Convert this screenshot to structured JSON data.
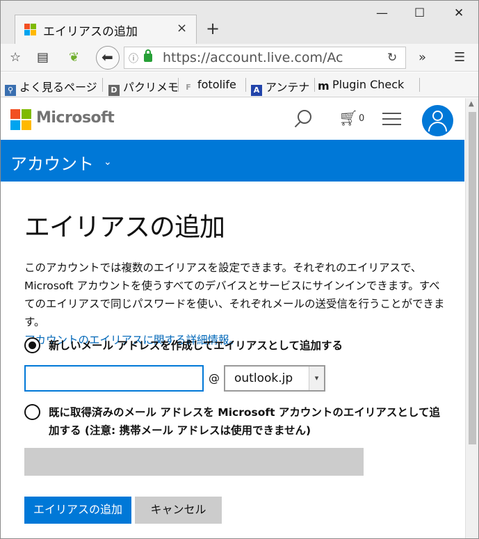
{
  "browser": {
    "tab_title": "エイリアスの追加",
    "tab_close": "×",
    "new_tab": "+",
    "window_controls": {
      "minimize": "—",
      "maximize": "☐",
      "close": "✕"
    },
    "url": "https://account.live.com/Ac",
    "toolbar_icons": [
      "star-icon",
      "reader-icon",
      "leaf-icon",
      "back-icon",
      "info-icon",
      "lock-icon",
      "reload-icon",
      "overflow-icon",
      "menu-icon"
    ],
    "bookmarks": [
      {
        "label": "よく見るページ",
        "icon": "magnifier-icon"
      },
      {
        "label": "パクリメモ",
        "icon": "D"
      },
      {
        "label": "fotolife",
        "icon": "F"
      },
      {
        "label": "アンテナ",
        "icon": "A"
      },
      {
        "label": "Plugin Check",
        "icon": "m"
      }
    ]
  },
  "header": {
    "brand": "Microsoft",
    "cart_count": "0",
    "logo_colors": [
      "#f25022",
      "#7fba00",
      "#00a4ef",
      "#ffb900"
    ]
  },
  "account_bar": {
    "title": "アカウント",
    "chevron": "⌄"
  },
  "main": {
    "title": "エイリアスの追加",
    "description": "このアカウントでは複数のエイリアスを設定できます。それぞれのエイリアスで、Microsoft アカウントを使うすべてのデバイスとサービスにサインインできます。すべてのエイリアスで同じパスワードを使い、それぞれメールの送受信を行うことができます。",
    "more_info_link": "アカウントのエイリアスに関する詳細情報。",
    "option_new": "新しいメール アドレスを作成してエイリアスとして追加する",
    "email_value": "",
    "at_sign": "@",
    "domain_selected": "outlook.jp",
    "option_existing": "既に取得済みのメール アドレスを Microsoft アカウントのエイリアスとして追加する (注意: 携帯メール アドレスは使用できません)",
    "existing_value": "",
    "add_button": "エイリアスの追加",
    "cancel_button": "キャンセル"
  },
  "colors": {
    "accent": "#0078d7",
    "link": "#0067b8",
    "disabled": "#cccccc"
  }
}
